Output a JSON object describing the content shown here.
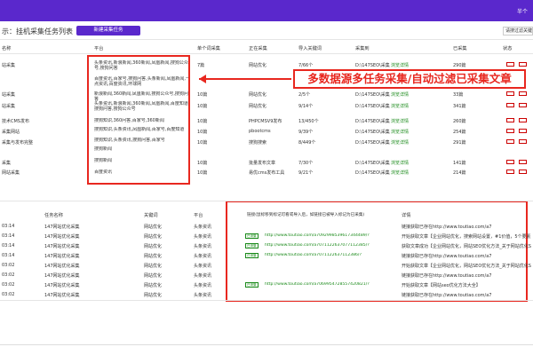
{
  "topbar": {
    "right_text": "半个"
  },
  "toolbar": {
    "title": "示：挂机采集任务列表",
    "new_button": "新建采集任务",
    "filter_text": "请搜过滤关键词"
  },
  "table": {
    "headers": [
      "名称",
      "平台",
      "单个词采集",
      "正在采集",
      "导入关键词",
      "采集到",
      "已采集",
      "状态"
    ],
    "rows": [
      {
        "name": "站采集",
        "platform": "头条资讯,新浪新闻,360新闻,凤凰新闻,搜狗公众号,搜狗问答",
        "per": "7篇",
        "status": "网站优化",
        "kw": "7/66个",
        "dir": "D:\\147SEO\\采集",
        "view": "浏览详情",
        "count": "290篇"
      },
      {
        "name": "站采集",
        "platform": "百度资讯,百家号,搜狗问答,头条新闻,凤凰新闻,一点资讯,百度资讯,环球网",
        "per": "",
        "status": "",
        "kw": "",
        "dir": "",
        "view": "",
        "count": ""
      },
      {
        "name": "站采集",
        "platform": "新浪新闻,360新闻,凤凰新闻,搜狗公众号,搜狗问答",
        "per": "10篇",
        "status": "网站优化",
        "kw": "2/5个",
        "dir": "D:\\147SEO\\采集",
        "view": "浏览详情",
        "count": "33篇"
      },
      {
        "name": "站采集",
        "platform": "头条资讯,新浪新闻,360新闻,凤凰新闻,百度知道,搜狗问答,搜狗公众号",
        "per": "10篇",
        "status": "网站优化",
        "kw": "9/14个",
        "dir": "D:\\147SEO\\采集",
        "view": "浏览详情",
        "count": "341篇"
      },
      {
        "name": "技术CMS发布",
        "platform": "搜狗知识,360问答,百家号,360新闻",
        "per": "10篇",
        "status": "PHPCMSV9发布",
        "kw": "13/450个",
        "dir": "D:\\147SEO\\采集",
        "view": "浏览详情",
        "count": "260篇"
      },
      {
        "name": "采集网站",
        "platform": "搜狗知识,头条资讯,凤凰新闻,百家号,百度知道",
        "per": "10篇",
        "status": "pbootcms",
        "kw": "9/39个",
        "dir": "D:\\147SEO\\采集",
        "view": "浏览详情",
        "count": "254篇"
      },
      {
        "name": "采集与发布完整",
        "platform": "搜狗知识,头条资讯,搜狗问答,百家号",
        "per": "10篇",
        "status": "搜狗搜索",
        "kw": "8/449个",
        "dir": "D:\\147SEO\\采集",
        "view": "浏览详情",
        "count": "291篇"
      },
      {
        "name": "",
        "platform": "搜狗新闻",
        "per": "",
        "status": "",
        "kw": "",
        "dir": "",
        "view": "",
        "count": ""
      },
      {
        "name": "采集",
        "platform": "搜狗新闻",
        "per": "10篇",
        "status": "批量发布文章",
        "kw": "7/30个",
        "dir": "D:\\147SEO\\采集",
        "view": "浏览详情",
        "count": "141篇"
      },
      {
        "name": "网站采集",
        "platform": "百度资讯",
        "per": "10篇",
        "status": "易优cms发布工具",
        "kw": "9/21个",
        "dir": "D:\\147SEO\\采集",
        "view": "浏览详情",
        "count": "214篇"
      }
    ]
  },
  "banner": {
    "text": "多数据源多任务采集/自动过滤已采集文章"
  },
  "log": {
    "headers": [
      "任务名称",
      "关键词",
      "平台",
      "链接(鼠标移到标记可看或导入后，如链接已被导入标记为已采集)",
      "详情"
    ],
    "rows": [
      {
        "time": "03:14",
        "task": "147网站优化采集",
        "kw": "网站优化",
        "platform": "头条资讯",
        "tag": "",
        "link": "",
        "detail": "链接获取已存在http://www.toutiao.com/a7"
      },
      {
        "time": "03:14",
        "task": "147网站优化采集",
        "kw": "网站优化",
        "platform": "头条资讯",
        "tag": "已采集",
        "link": "http://www.toutiao.com/a7092998539617344489/?",
        "detail": "开始获取文章【企业网站优化，搜索网站设置，#1价值，5个要素】"
      },
      {
        "time": "03:14",
        "task": "147网站优化采集",
        "kw": "网站优化",
        "platform": "头条资讯",
        "tag": "已采集",
        "link": "http://www.toutiao.com/a7071122637077112385/?",
        "detail": "获取文章成功【企业网站优化，网站SEO优化方法_关于网站优化SEO的简单】"
      },
      {
        "time": "03:14",
        "task": "147网站优化采集",
        "kw": "网站优化",
        "platform": "头条资讯",
        "tag": "已采集",
        "link": "http://www.toutiao.com/a7071122637112386/?",
        "detail": "链接获取已存在http://www.toutiao.com/a7"
      },
      {
        "time": "03:02",
        "task": "147网站优化采集",
        "kw": "网站优化",
        "platform": "头条资讯",
        "tag": "",
        "link": "",
        "detail": "开始获取文章【企业网站优化，网站SEO优化方法_关于网站优化SEO的简单】"
      },
      {
        "time": "03:02",
        "task": "147网站优化采集",
        "kw": "网站优化",
        "platform": "头条资讯",
        "tag": "",
        "link": "",
        "detail": "链接获取已存在http://www.toutiao.com/a7"
      },
      {
        "time": "03:02",
        "task": "147网站优化采集",
        "kw": "网站优化",
        "platform": "头条资讯",
        "tag": "已采集",
        "link": "http://www.toutiao.com/a7069954728557420821/?",
        "detail": "开始获取文章【网站seo优化方法大全】"
      },
      {
        "time": "03:02",
        "task": "147网站优化采集",
        "kw": "网站优化",
        "platform": "头条资讯",
        "tag": "",
        "link": "",
        "detail": "链接获取已存在http://www.toutiao.com/a7"
      }
    ]
  },
  "colors": {
    "brand": "#5a28cc",
    "highlight": "#e8271f",
    "link": "#1a8a1a"
  }
}
